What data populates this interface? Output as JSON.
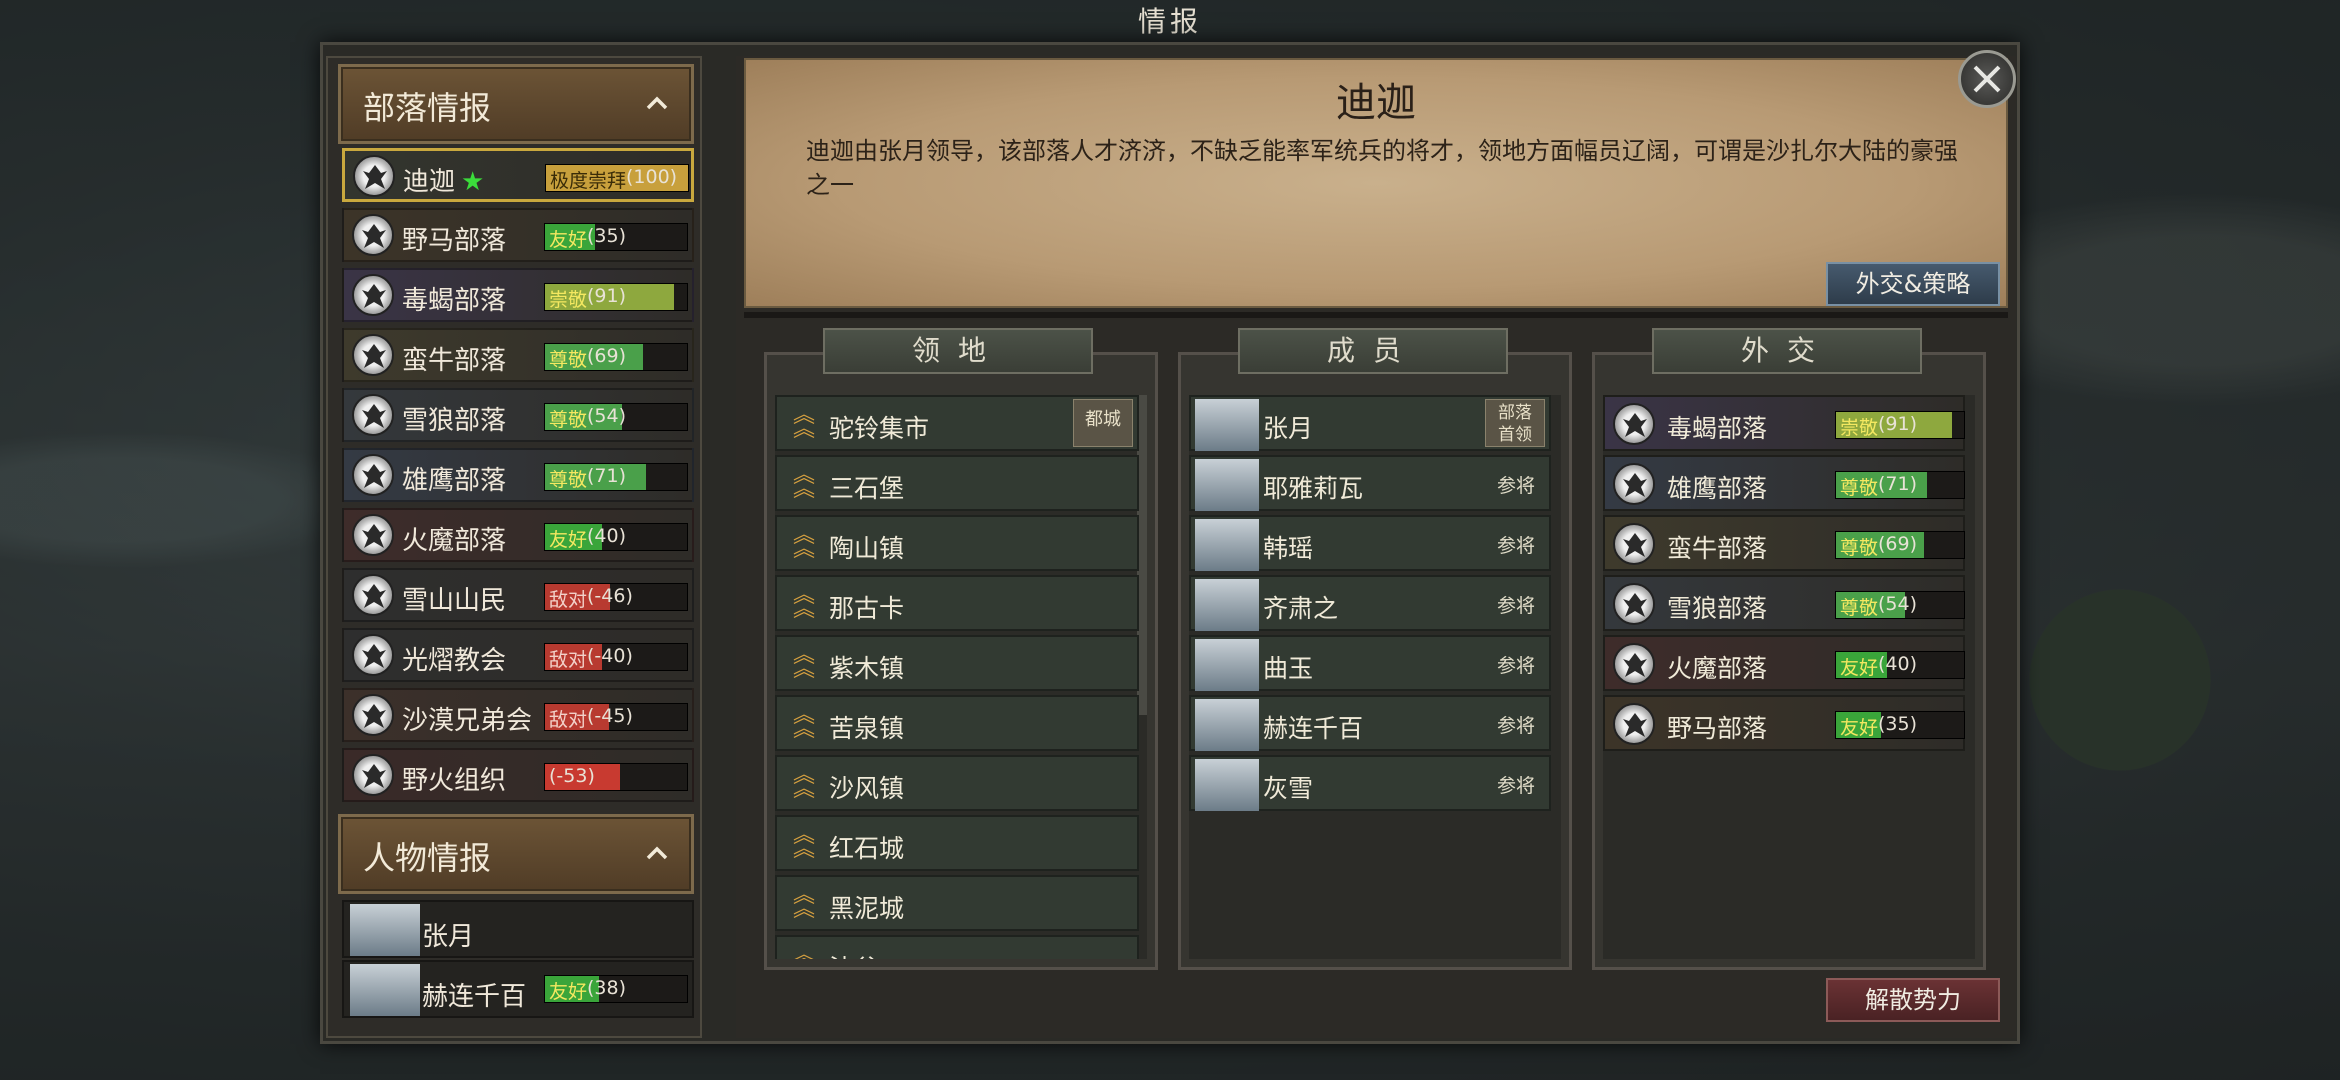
{
  "window_title": "情报",
  "left_panel": {
    "tribe_section_title": "部落情报",
    "tribes": [
      {
        "name": "迪迦",
        "starred": true,
        "relation": "极度崇拜",
        "value": "(100)",
        "color": "#c8a03c",
        "level": 1.0
      },
      {
        "name": "野马部落",
        "relation": "友好",
        "value": "(35)",
        "color": "#3aa53a",
        "level": 0.35
      },
      {
        "name": "毒蝎部落",
        "relation": "崇敬",
        "value": "(91)",
        "color": "#8ea83e",
        "level": 0.91
      },
      {
        "name": "蛮牛部落",
        "relation": "尊敬",
        "value": "(69)",
        "color": "#4aa04a",
        "level": 0.69
      },
      {
        "name": "雪狼部落",
        "relation": "尊敬",
        "value": "(54)",
        "color": "#4aa04a",
        "level": 0.54
      },
      {
        "name": "雄鹰部落",
        "relation": "尊敬",
        "value": "(71)",
        "color": "#4aa04a",
        "level": 0.71
      },
      {
        "name": "火魔部落",
        "relation": "友好",
        "value": "(40)",
        "color": "#3aa53a",
        "level": 0.4
      },
      {
        "name": "雪山山民",
        "relation": "敌对",
        "value": "(-46)",
        "color": "#b83a30",
        "level": 0.46
      },
      {
        "name": "光熠教会",
        "relation": "敌对",
        "value": "(-40)",
        "color": "#b83a30",
        "level": 0.4
      },
      {
        "name": "沙漠兄弟会",
        "relation": "敌对",
        "value": "(-45)",
        "color": "#b83a30",
        "level": 0.45
      },
      {
        "name": "野火组织",
        "relation": "",
        "value": "(-53)",
        "color": "#c83a30",
        "level": 0.53
      }
    ],
    "character_section_title": "人物情报",
    "characters": [
      {
        "name": "张月",
        "relation": "",
        "value": ""
      },
      {
        "name": "赫连千百",
        "relation": "友好",
        "value": "(38)",
        "color": "#3aa53a",
        "level": 0.38
      }
    ]
  },
  "detail": {
    "title": "迪迦",
    "description": "迪迦由张月领导，该部落人才济济，不缺乏能率军统兵的将才，领地方面幅员辽阔，可谓是沙扎尔大陆的豪强之一",
    "diplomacy_button": "外交&策略",
    "disband_button": "解散势力"
  },
  "territory": {
    "header": "领地",
    "items": [
      {
        "name": "驼铃集市",
        "tag": "都城"
      },
      {
        "name": "三石堡"
      },
      {
        "name": "陶山镇"
      },
      {
        "name": "那古卡"
      },
      {
        "name": "紫木镇"
      },
      {
        "name": "苦泉镇"
      },
      {
        "name": "沙风镇"
      },
      {
        "name": "红石城"
      },
      {
        "name": "黑泥城"
      },
      {
        "name": "沙谷"
      }
    ]
  },
  "members": {
    "header": "成员",
    "items": [
      {
        "name": "张月",
        "role": "部落首领"
      },
      {
        "name": "耶雅莉瓦",
        "role": "参将"
      },
      {
        "name": "韩瑶",
        "role": "参将"
      },
      {
        "name": "齐肃之",
        "role": "参将"
      },
      {
        "name": "曲玉",
        "role": "参将"
      },
      {
        "name": "赫连千百",
        "role": "参将"
      },
      {
        "name": "灰雪",
        "role": "参将"
      }
    ]
  },
  "diplomacy": {
    "header": "外交",
    "items": [
      {
        "name": "毒蝎部落",
        "relation": "崇敬",
        "value": "(91)",
        "color": "#8ea83e",
        "level": 0.91,
        "bg": "#3a3446"
      },
      {
        "name": "雄鹰部落",
        "relation": "尊敬",
        "value": "(71)",
        "color": "#4aa04a",
        "level": 0.71,
        "bg": "#343a44"
      },
      {
        "name": "蛮牛部落",
        "relation": "尊敬",
        "value": "(69)",
        "color": "#4aa04a",
        "level": 0.69,
        "bg": "#3e3a2c"
      },
      {
        "name": "雪狼部落",
        "relation": "尊敬",
        "value": "(54)",
        "color": "#4aa04a",
        "level": 0.54,
        "bg": "#34383c"
      },
      {
        "name": "火魔部落",
        "relation": "友好",
        "value": "(40)",
        "color": "#3aa53a",
        "level": 0.4,
        "bg": "#3e2c2a"
      },
      {
        "name": "野马部落",
        "relation": "友好",
        "value": "(35)",
        "color": "#3aa53a",
        "level": 0.35,
        "bg": "#3c3428"
      }
    ]
  }
}
